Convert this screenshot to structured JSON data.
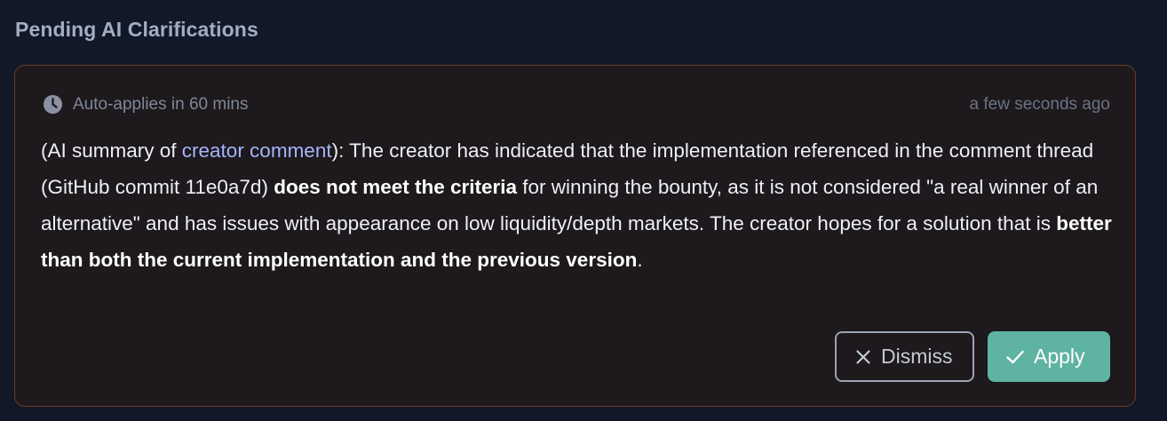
{
  "section": {
    "title": "Pending AI Clarifications"
  },
  "card": {
    "auto_applies": "Auto-applies in 60 mins",
    "timestamp": "a few seconds ago",
    "body": {
      "p1": "(AI summary of ",
      "link": "creator comment",
      "p2": "): The creator has indicated that the implementation referenced in the comment thread (GitHub commit 11e0a7d) ",
      "bold1": "does not meet the criteria",
      "p3": " for winning the bounty, as it is not considered \"a real winner of an alternative\" and has issues with appearance on low liquidity/depth markets. The creator hopes for a solution that is ",
      "bold2": "better than both the current implementation and the previous version",
      "p4": "."
    },
    "actions": {
      "dismiss_label": "Dismiss",
      "apply_label": "Apply"
    }
  },
  "colors": {
    "background": "#111827",
    "card_background": "#1d191c",
    "card_border": "#6b3a27",
    "link": "#a5b4fc",
    "apply_button": "#5fb3a2"
  },
  "icons": {
    "meta": "clock-icon",
    "dismiss": "close-icon",
    "apply": "check-icon"
  }
}
